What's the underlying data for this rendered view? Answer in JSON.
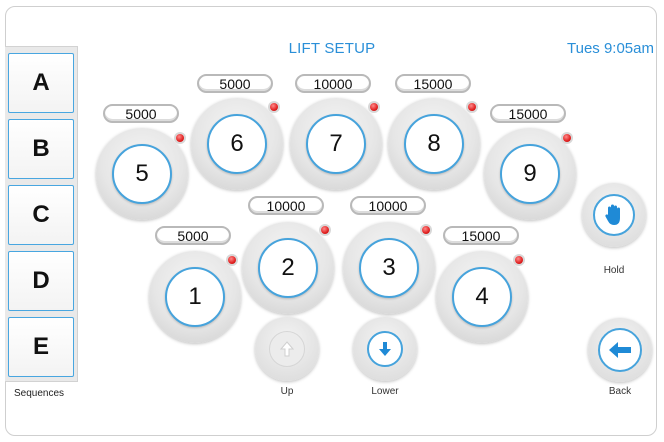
{
  "header": {
    "title": "LIFT SETUP",
    "clock": "Tues  9:05am"
  },
  "sequences": {
    "label": "Sequences",
    "buttons": [
      "A",
      "B",
      "C",
      "D",
      "E"
    ]
  },
  "lifts": [
    {
      "id": "1",
      "weight": "5000"
    },
    {
      "id": "2",
      "weight": "10000"
    },
    {
      "id": "3",
      "weight": "10000"
    },
    {
      "id": "4",
      "weight": "15000"
    },
    {
      "id": "5",
      "weight": "5000"
    },
    {
      "id": "6",
      "weight": "5000"
    },
    {
      "id": "7",
      "weight": "10000"
    },
    {
      "id": "8",
      "weight": "15000"
    },
    {
      "id": "9",
      "weight": "15000"
    }
  ],
  "controls": {
    "up": {
      "label": "Up",
      "icon": "up-arrow-icon",
      "enabled": false
    },
    "lower": {
      "label": "Lower",
      "icon": "down-arrow-icon",
      "enabled": true
    },
    "hold": {
      "label": "Hold",
      "icon": "hand-icon"
    },
    "back": {
      "label": "Back",
      "icon": "back-arrow-icon"
    }
  },
  "colors": {
    "accent": "#2a8fd8",
    "led": "#e02020",
    "disabled": "#cfcfcf"
  }
}
